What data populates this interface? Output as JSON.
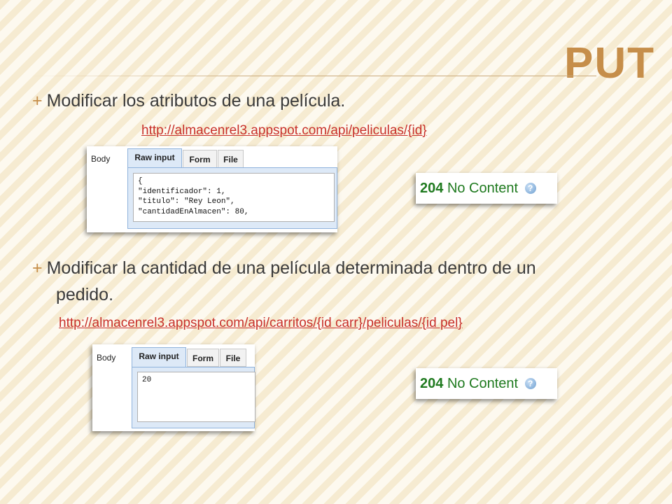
{
  "slide": {
    "title": "PUT",
    "bullets": [
      {
        "plus": "+",
        "text": "Modificar los atributos de una película.",
        "cont": ""
      },
      {
        "plus": "+",
        "text": "Modificar la cantidad de una película determinada dentro de un",
        "cont": "pedido."
      }
    ],
    "links": [
      "http://almacenrel3.appspot.com/api/peliculas/{id}",
      "http://almacenrel3.appspot.com/api/carritos/{id carr}/peliculas/{id pel}"
    ]
  },
  "panel1": {
    "label": "Body",
    "tabs": [
      "Raw input",
      "Form",
      "File"
    ],
    "active_tab": "Raw input",
    "content": "{\n\"identificador\": 1,\n\"titulo\": \"Rey Leon\",\n\"cantidadEnAlmacen\": 80,"
  },
  "panel2": {
    "label": "Body",
    "tabs": [
      "Raw input",
      "Form",
      "File"
    ],
    "active_tab": "Raw input",
    "content": "20"
  },
  "status1": {
    "code": "204",
    "text": "No Content",
    "icon": "help-icon"
  },
  "status2": {
    "code": "204",
    "text": "No Content",
    "icon": "help-icon"
  },
  "colors": {
    "accent": "#c68e4a",
    "link": "#c8302a",
    "status": "#1f7a1f"
  }
}
